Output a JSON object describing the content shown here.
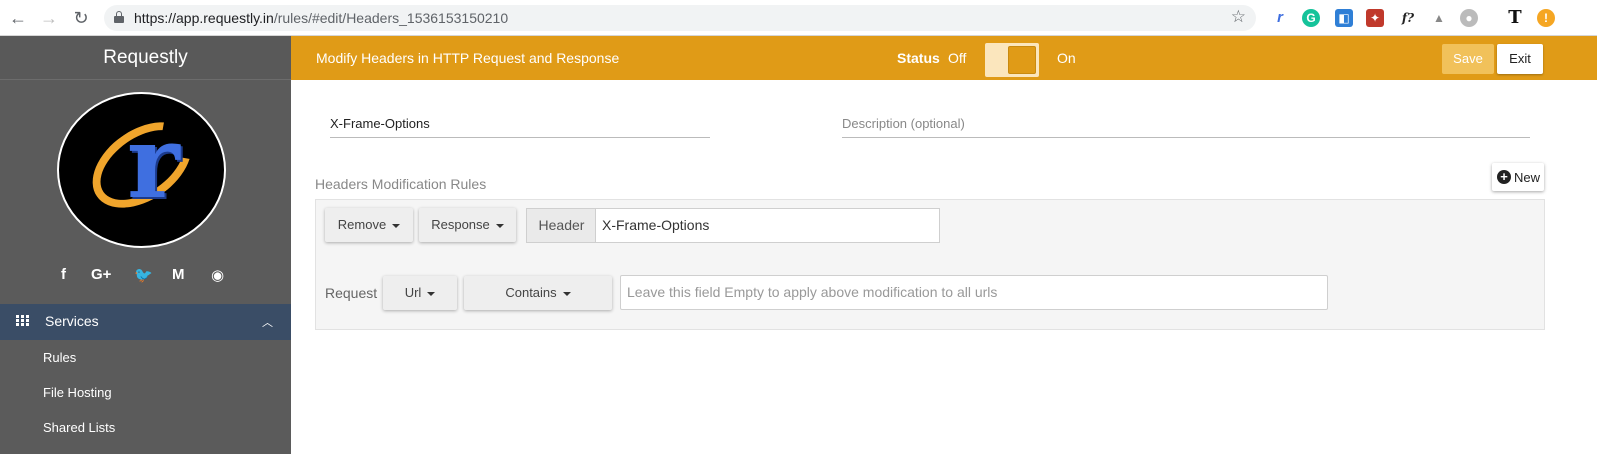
{
  "browser": {
    "url_host": "https://app.requestly.in",
    "url_path": "/rules/#edit/Headers_1536153150210",
    "back_icon": "←",
    "forward_icon": "→",
    "reload_icon": "↻",
    "star_icon": "☆"
  },
  "sidebar": {
    "brand": "Requestly",
    "social_icons": [
      "facebook-icon",
      "google-plus-icon",
      "twitter-icon",
      "medium-icon",
      "chrome-icon"
    ],
    "social_glyphs": [
      "f",
      "G+",
      "🐦",
      "M",
      "◉"
    ],
    "services_label": "Services",
    "items": [
      {
        "label": "Rules"
      },
      {
        "label": "File Hosting"
      },
      {
        "label": "Shared Lists"
      }
    ]
  },
  "topbar": {
    "title": "Modify Headers in HTTP Request and Response",
    "status_label": "Status",
    "off_label": "Off",
    "on_label": "On",
    "save_label": "Save",
    "exit_label": "Exit",
    "accent_color": "#e09b17"
  },
  "rule": {
    "name_value": "X-Frame-Options",
    "description_placeholder": "Description (optional)",
    "section_label": "Headers Modification Rules",
    "new_label": "New",
    "action_dropdown": "Remove",
    "target_dropdown": "Response",
    "header_addon": "Header",
    "header_value": "X-Frame-Options",
    "request_label": "Request",
    "source_key_dropdown": "Url",
    "operator_dropdown": "Contains",
    "source_placeholder": "Leave this field Empty to apply above modification to all urls"
  }
}
